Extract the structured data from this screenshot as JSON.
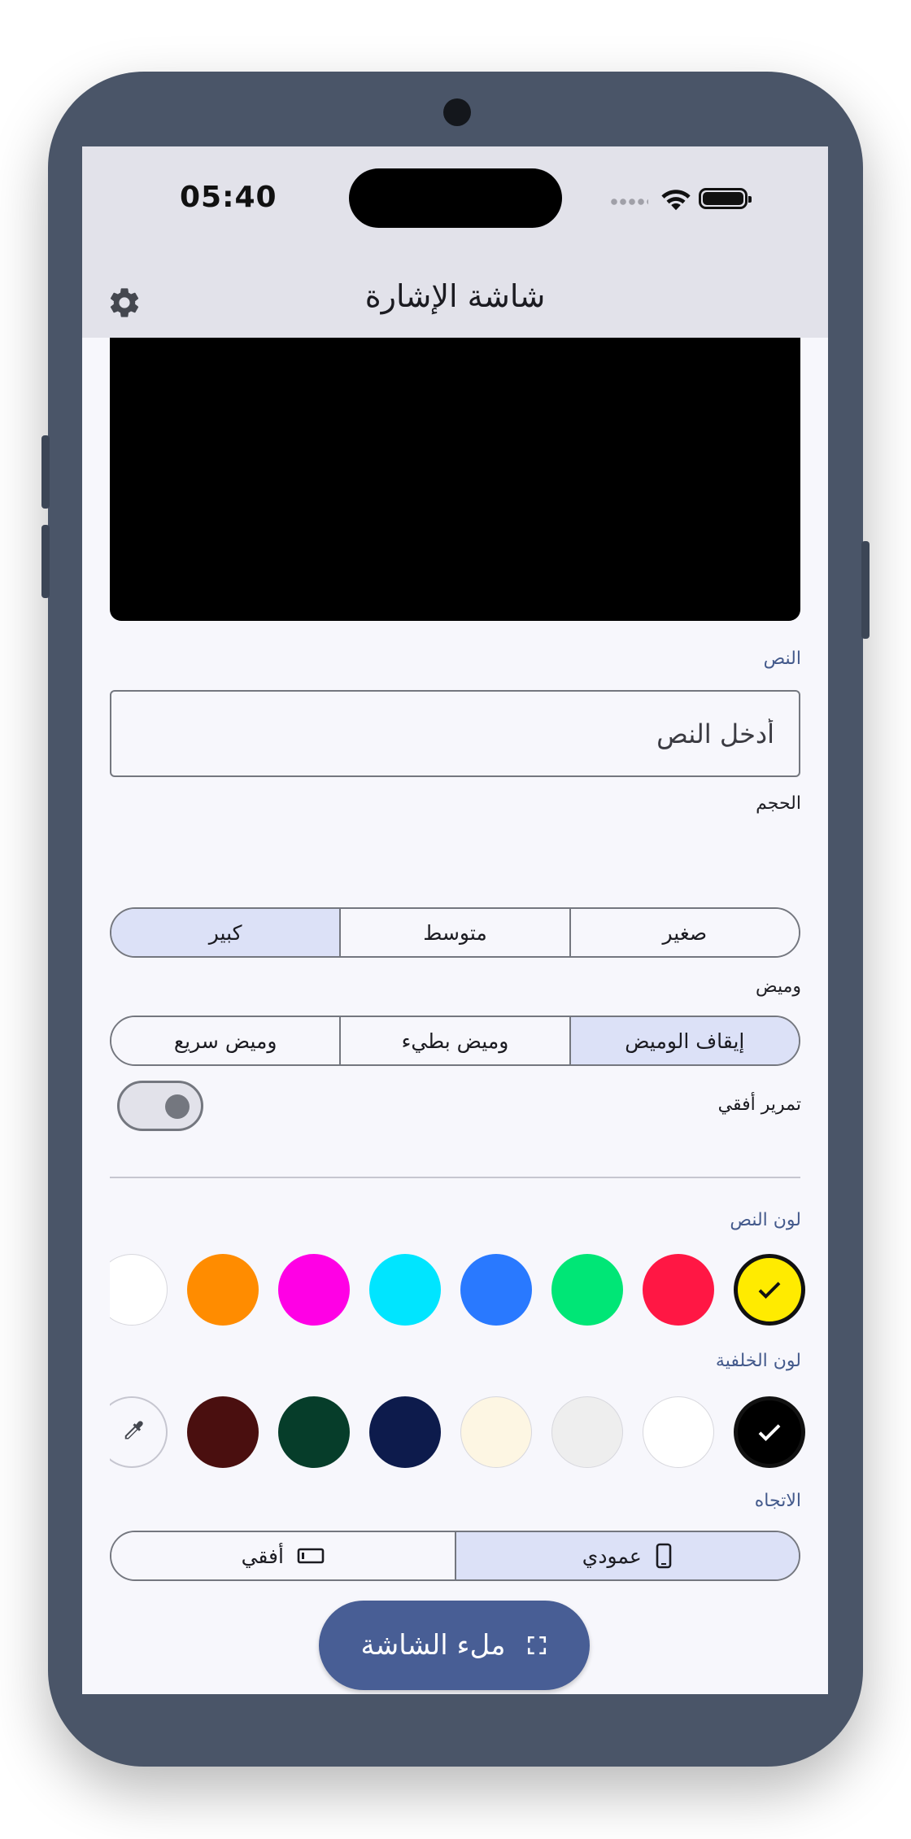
{
  "status_bar": {
    "time": "05:40"
  },
  "app_bar": {
    "title": "شاشة الإشارة",
    "settings_icon": "gear-icon"
  },
  "text_section": {
    "label": "النص",
    "placeholder": "أدخل النص"
  },
  "size_section": {
    "label": "الحجم",
    "options": [
      "صغير",
      "متوسط",
      "كبير"
    ],
    "selected": "كبير"
  },
  "blink_section": {
    "label": "وميض",
    "options": [
      "إيقاف الوميض",
      "وميض بطيء",
      "وميض سريع"
    ],
    "selected": "إيقاف الوميض"
  },
  "scroll_toggle": {
    "label": "تمرير أفقي",
    "on": false
  },
  "text_color": {
    "label": "لون النص",
    "swatches": [
      "#ffeb00",
      "#ff1744",
      "#00e676",
      "#2979ff",
      "#00e5ff",
      "#ff00e5",
      "#ff8c00",
      "#ffffff"
    ],
    "selected": "#ffeb00"
  },
  "background_color": {
    "label": "لون الخلفية",
    "swatches": [
      "#000000",
      "#ffffff",
      "#eeeeee",
      "#fdf6e3",
      "#0d1b4c",
      "#063d2a",
      "#4a0f0f"
    ],
    "selected": "#000000",
    "picker_icon": "eyedropper-icon"
  },
  "orientation": {
    "label": "الاتجاه",
    "options": [
      "عمودي",
      "أفقي"
    ],
    "selected": "عمودي"
  },
  "fullscreen_button": {
    "label": "ملء الشاشة"
  },
  "colors": {
    "accent": "#485e95",
    "selected_segment": "#dce1f7",
    "frame": "#4a5568"
  }
}
